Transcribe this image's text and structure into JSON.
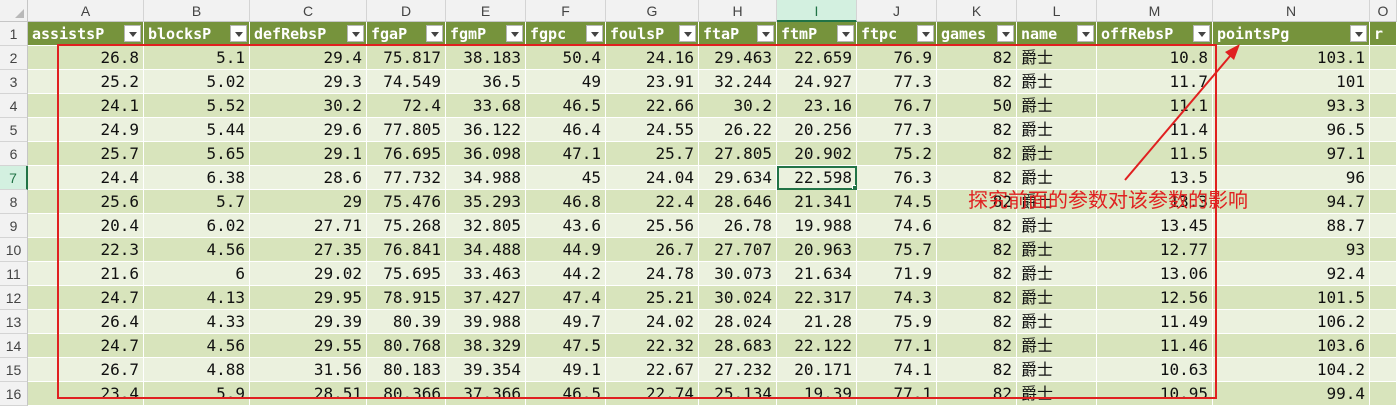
{
  "columns": [
    "A",
    "B",
    "C",
    "D",
    "E",
    "F",
    "G",
    "H",
    "I",
    "J",
    "K",
    "L",
    "M",
    "N",
    "O"
  ],
  "selected_column": "I",
  "selected_row": "7",
  "row_numbers": [
    "1",
    "2",
    "3",
    "4",
    "5",
    "6",
    "7",
    "8",
    "9",
    "10",
    "11",
    "12",
    "13",
    "14",
    "15",
    "16"
  ],
  "headers": [
    "assistsP",
    "blocksP",
    "defRebsP",
    "fgaP",
    "fgmP",
    "fgpc",
    "foulsP",
    "ftaP",
    "ftmP",
    "ftpc",
    "games",
    "name",
    "offRebsP",
    "pointsPg",
    "r"
  ],
  "rows": [
    [
      "26.8",
      "5.1",
      "29.4",
      "75.817",
      "38.183",
      "50.4",
      "24.16",
      "29.463",
      "22.659",
      "76.9",
      "82",
      "爵士",
      "10.8",
      "103.1",
      ""
    ],
    [
      "25.2",
      "5.02",
      "29.3",
      "74.549",
      "36.5",
      "49",
      "23.91",
      "32.244",
      "24.927",
      "77.3",
      "82",
      "爵士",
      "11.7",
      "101",
      ""
    ],
    [
      "24.1",
      "5.52",
      "30.2",
      "72.4",
      "33.68",
      "46.5",
      "22.66",
      "30.2",
      "23.16",
      "76.7",
      "50",
      "爵士",
      "11.1",
      "93.3",
      ""
    ],
    [
      "24.9",
      "5.44",
      "29.6",
      "77.805",
      "36.122",
      "46.4",
      "24.55",
      "26.22",
      "20.256",
      "77.3",
      "82",
      "爵士",
      "11.4",
      "96.5",
      ""
    ],
    [
      "25.7",
      "5.65",
      "29.1",
      "76.695",
      "36.098",
      "47.1",
      "25.7",
      "27.805",
      "20.902",
      "75.2",
      "82",
      "爵士",
      "11.5",
      "97.1",
      ""
    ],
    [
      "24.4",
      "6.38",
      "28.6",
      "77.732",
      "34.988",
      "45",
      "24.04",
      "29.634",
      "22.598",
      "76.3",
      "82",
      "爵士",
      "13.5",
      "96",
      ""
    ],
    [
      "25.6",
      "5.7",
      "29",
      "75.476",
      "35.293",
      "46.8",
      "22.4",
      "28.646",
      "21.341",
      "74.5",
      "82",
      "爵士",
      "13.3",
      "94.7",
      ""
    ],
    [
      "20.4",
      "6.02",
      "27.71",
      "75.268",
      "32.805",
      "43.6",
      "25.56",
      "26.78",
      "19.988",
      "74.6",
      "82",
      "爵士",
      "13.45",
      "88.7",
      ""
    ],
    [
      "22.3",
      "4.56",
      "27.35",
      "76.841",
      "34.488",
      "44.9",
      "26.7",
      "27.707",
      "20.963",
      "75.7",
      "82",
      "爵士",
      "12.77",
      "93",
      ""
    ],
    [
      "21.6",
      "6",
      "29.02",
      "75.695",
      "33.463",
      "44.2",
      "24.78",
      "30.073",
      "21.634",
      "71.9",
      "82",
      "爵士",
      "13.06",
      "92.4",
      ""
    ],
    [
      "24.7",
      "4.13",
      "29.95",
      "78.915",
      "37.427",
      "47.4",
      "25.21",
      "30.024",
      "22.317",
      "74.3",
      "82",
      "爵士",
      "12.56",
      "101.5",
      ""
    ],
    [
      "26.4",
      "4.33",
      "29.39",
      "80.39",
      "39.988",
      "49.7",
      "24.02",
      "28.024",
      "21.28",
      "75.9",
      "82",
      "爵士",
      "11.49",
      "106.2",
      ""
    ],
    [
      "24.7",
      "4.56",
      "29.55",
      "80.768",
      "38.329",
      "47.5",
      "22.32",
      "28.683",
      "22.122",
      "77.1",
      "82",
      "爵士",
      "11.46",
      "103.6",
      ""
    ],
    [
      "26.7",
      "4.88",
      "31.56",
      "80.183",
      "39.354",
      "49.1",
      "22.67",
      "27.232",
      "20.171",
      "74.1",
      "82",
      "爵士",
      "10.63",
      "104.2",
      ""
    ],
    [
      "23.4",
      "5.9",
      "28.51",
      "80.366",
      "37.366",
      "46.5",
      "22.74",
      "25.134",
      "19.39",
      "77.1",
      "82",
      "爵士",
      "10.95",
      "99.4",
      ""
    ]
  ],
  "annotation": "探究前面的参数对该参数的影响",
  "colors": {
    "header_green": "#76933c",
    "band_dark": "#d8e4bc",
    "band_light": "#ebf1de",
    "annotation_red": "#e02020",
    "select_green": "#217346"
  }
}
